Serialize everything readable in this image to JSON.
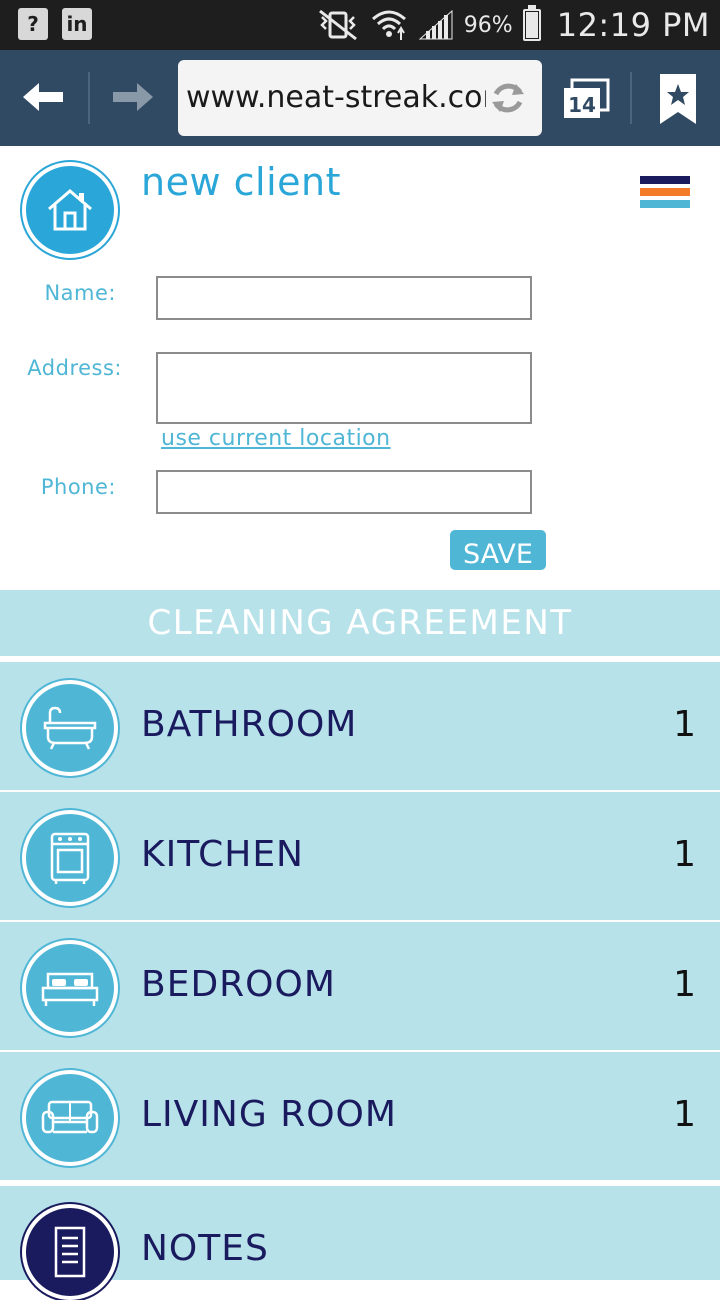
{
  "status_bar": {
    "left_badges": [
      "?",
      "in"
    ],
    "battery_percent": "96%",
    "battery_level": 0.96,
    "time": "12:19 PM"
  },
  "browser": {
    "url": "www.neat-streak.com",
    "tab_count": "14"
  },
  "header": {
    "title": "new client"
  },
  "form": {
    "name_label": "Name:",
    "name_value": "",
    "address_label": "Address:",
    "address_value": "",
    "location_link": "use current location",
    "phone_label": "Phone:",
    "phone_value": "",
    "save_label": "SAVE"
  },
  "agreement": {
    "heading": "CLEANING AGREEMENT",
    "rooms": [
      {
        "label": "BATHROOM",
        "count": "1",
        "icon": "bathtub-icon"
      },
      {
        "label": "KITCHEN",
        "count": "1",
        "icon": "stove-icon"
      },
      {
        "label": "BEDROOM",
        "count": "1",
        "icon": "bed-icon"
      },
      {
        "label": "LIVING ROOM",
        "count": "1",
        "icon": "sofa-icon"
      }
    ],
    "notes_label": "NOTES"
  },
  "colors": {
    "accent": "#2aa6d8",
    "light_accent": "#4fb6d6",
    "row_bg": "#b8e2ea",
    "navy": "#1a1a5e",
    "browser_bar": "#314a63",
    "menu_stripes": [
      "#1a1a5e",
      "#f47a2a",
      "#4fb6d6"
    ]
  }
}
